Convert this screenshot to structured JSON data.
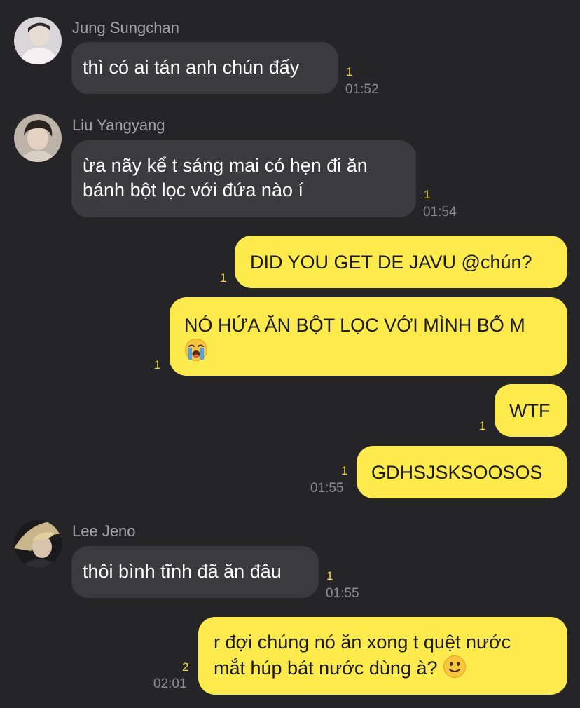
{
  "colors": {
    "background": "#252528",
    "incoming_bubble": "#3b3b3f",
    "outgoing_bubble": "#fdea4c",
    "unread_count": "#f5dd3c",
    "timestamp": "#8d8d93"
  },
  "messages": [
    {
      "sender": "Jung Sungchan",
      "avatar_icon": "user-avatar-icon",
      "lines": [
        "thì có ai tán anh chún đấy"
      ],
      "unread": "1",
      "time": "01:52"
    },
    {
      "sender": "Liu Yangyang",
      "avatar_icon": "user-avatar-icon",
      "lines": [
        "ừa nãy kể t sáng mai có hẹn đi ăn",
        "bánh bột lọc với đứa nào í"
      ],
      "unread": "1",
      "time": "01:54"
    },
    {
      "outgoing": true,
      "lines": [
        "DID YOU GET DE JAVU @chún?"
      ],
      "unread": "1"
    },
    {
      "outgoing": true,
      "lines": [
        "NÓ HỨA ĂN BỘT LỌC VỚI MÌNH BỐ M",
        ""
      ],
      "emoji": "loudly-crying-face",
      "unread": "1"
    },
    {
      "outgoing": true,
      "lines": [
        "WTF"
      ],
      "unread": "1"
    },
    {
      "outgoing": true,
      "lines": [
        "GDHSJSKSOOSOS"
      ],
      "unread": "1",
      "time": "01:55"
    },
    {
      "sender": "Lee Jeno",
      "avatar_icon": "user-avatar-icon",
      "lines": [
        "thôi bình tĩnh đã ăn đâu"
      ],
      "unread": "1",
      "time": "01:55"
    },
    {
      "outgoing": true,
      "lines": [
        "r đợi chúng nó ăn xong t quệt nước",
        "mắt húp bát nước dùng à? "
      ],
      "emoji": "slightly-smiling-face",
      "unread": "2",
      "time": "02:01"
    }
  ]
}
